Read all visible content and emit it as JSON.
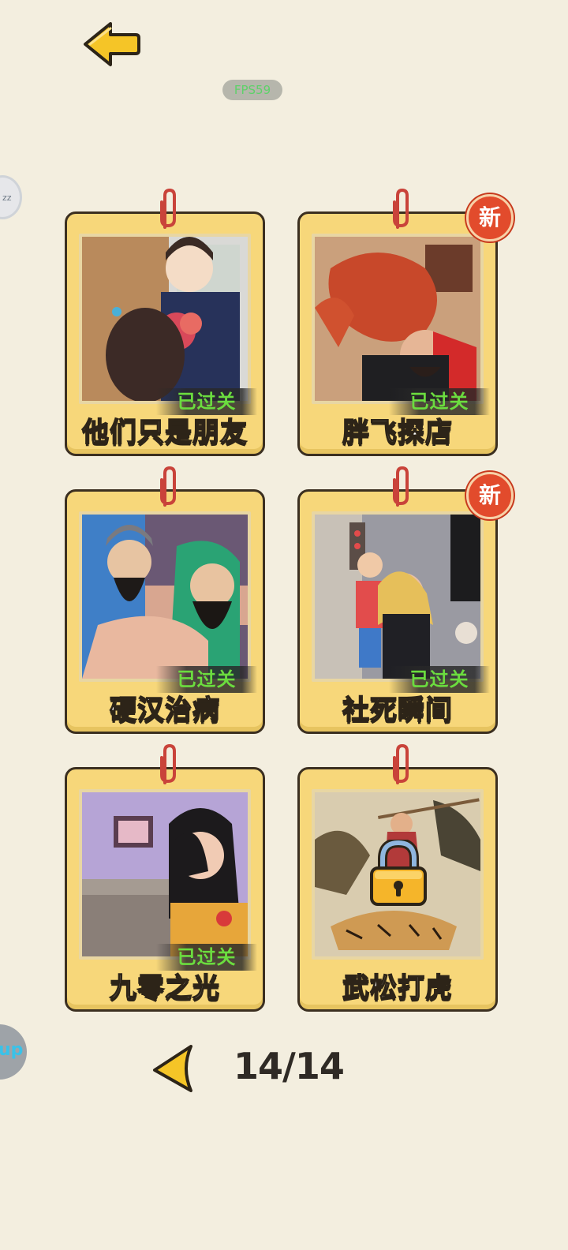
{
  "header": {
    "fps_label": "FPS59"
  },
  "side_widgets": {
    "top_label": "zz",
    "bottom_label": "up"
  },
  "levels": [
    {
      "title": "他们只是朋友",
      "status": "已过关",
      "is_new": false,
      "locked": false
    },
    {
      "title": "胖飞探店",
      "status": "已过关",
      "is_new": true,
      "new_label": "新",
      "locked": false
    },
    {
      "title": "硬汉治病",
      "status": "已过关",
      "is_new": false,
      "locked": false
    },
    {
      "title": "社死瞬间",
      "status": "已过关",
      "is_new": true,
      "new_label": "新",
      "locked": false
    },
    {
      "title": "九零之光",
      "status": "已过关",
      "is_new": false,
      "locked": false
    },
    {
      "title": "武松打虎",
      "status": "",
      "is_new": false,
      "locked": true
    }
  ],
  "pagination": {
    "indicator": "14/14"
  },
  "colors": {
    "background": "#f3eedf",
    "card_fill": "#f7d77a",
    "card_border": "#3b2f20",
    "status_text": "#6bdc3f",
    "new_badge": "#e24b2c",
    "arrow_fill": "#f5c527"
  },
  "icons": {
    "back": "left-arrow-icon",
    "prev_page": "left-triangle-icon",
    "lock": "padlock-icon",
    "clip": "paperclip-icon"
  }
}
